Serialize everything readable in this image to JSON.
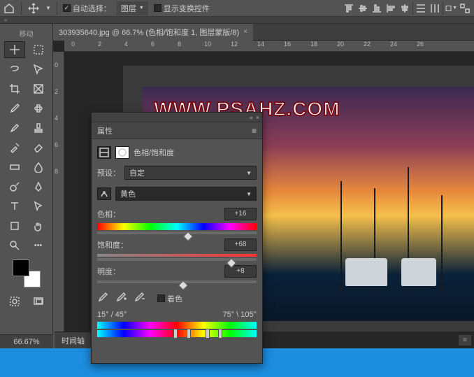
{
  "topbar": {
    "auto_select_label": "自动选择：",
    "layer_dd": "图层",
    "show_transform": "显示变换控件"
  },
  "toolbox_label": "移动",
  "tab": {
    "title": "303935640.jpg @ 66.7% (色相/饱和度 1, 图层蒙版/8)"
  },
  "ruler_h": [
    "0",
    "2",
    "4",
    "6",
    "8",
    "10",
    "12",
    "14",
    "16",
    "18",
    "20",
    "22",
    "24",
    "26"
  ],
  "ruler_v": [
    "0",
    "2",
    "4",
    "6",
    "8"
  ],
  "watermark": "WWW.PSAHZ.COM",
  "panel": {
    "title": "属性",
    "adj_name": "色相/饱和度",
    "preset_label": "预设：",
    "preset_value": "自定",
    "channel_value": "黄色",
    "hue_label": "色相：",
    "hue_value": "+16",
    "sat_label": "饱和度：",
    "sat_value": "+68",
    "light_label": "明度：",
    "light_value": "+8",
    "colorize": "着色",
    "range_left": "15° / 45°",
    "range_right": "75° \\ 105°"
  },
  "status": {
    "zoom": "66.67%",
    "timeline": "时间轴"
  }
}
